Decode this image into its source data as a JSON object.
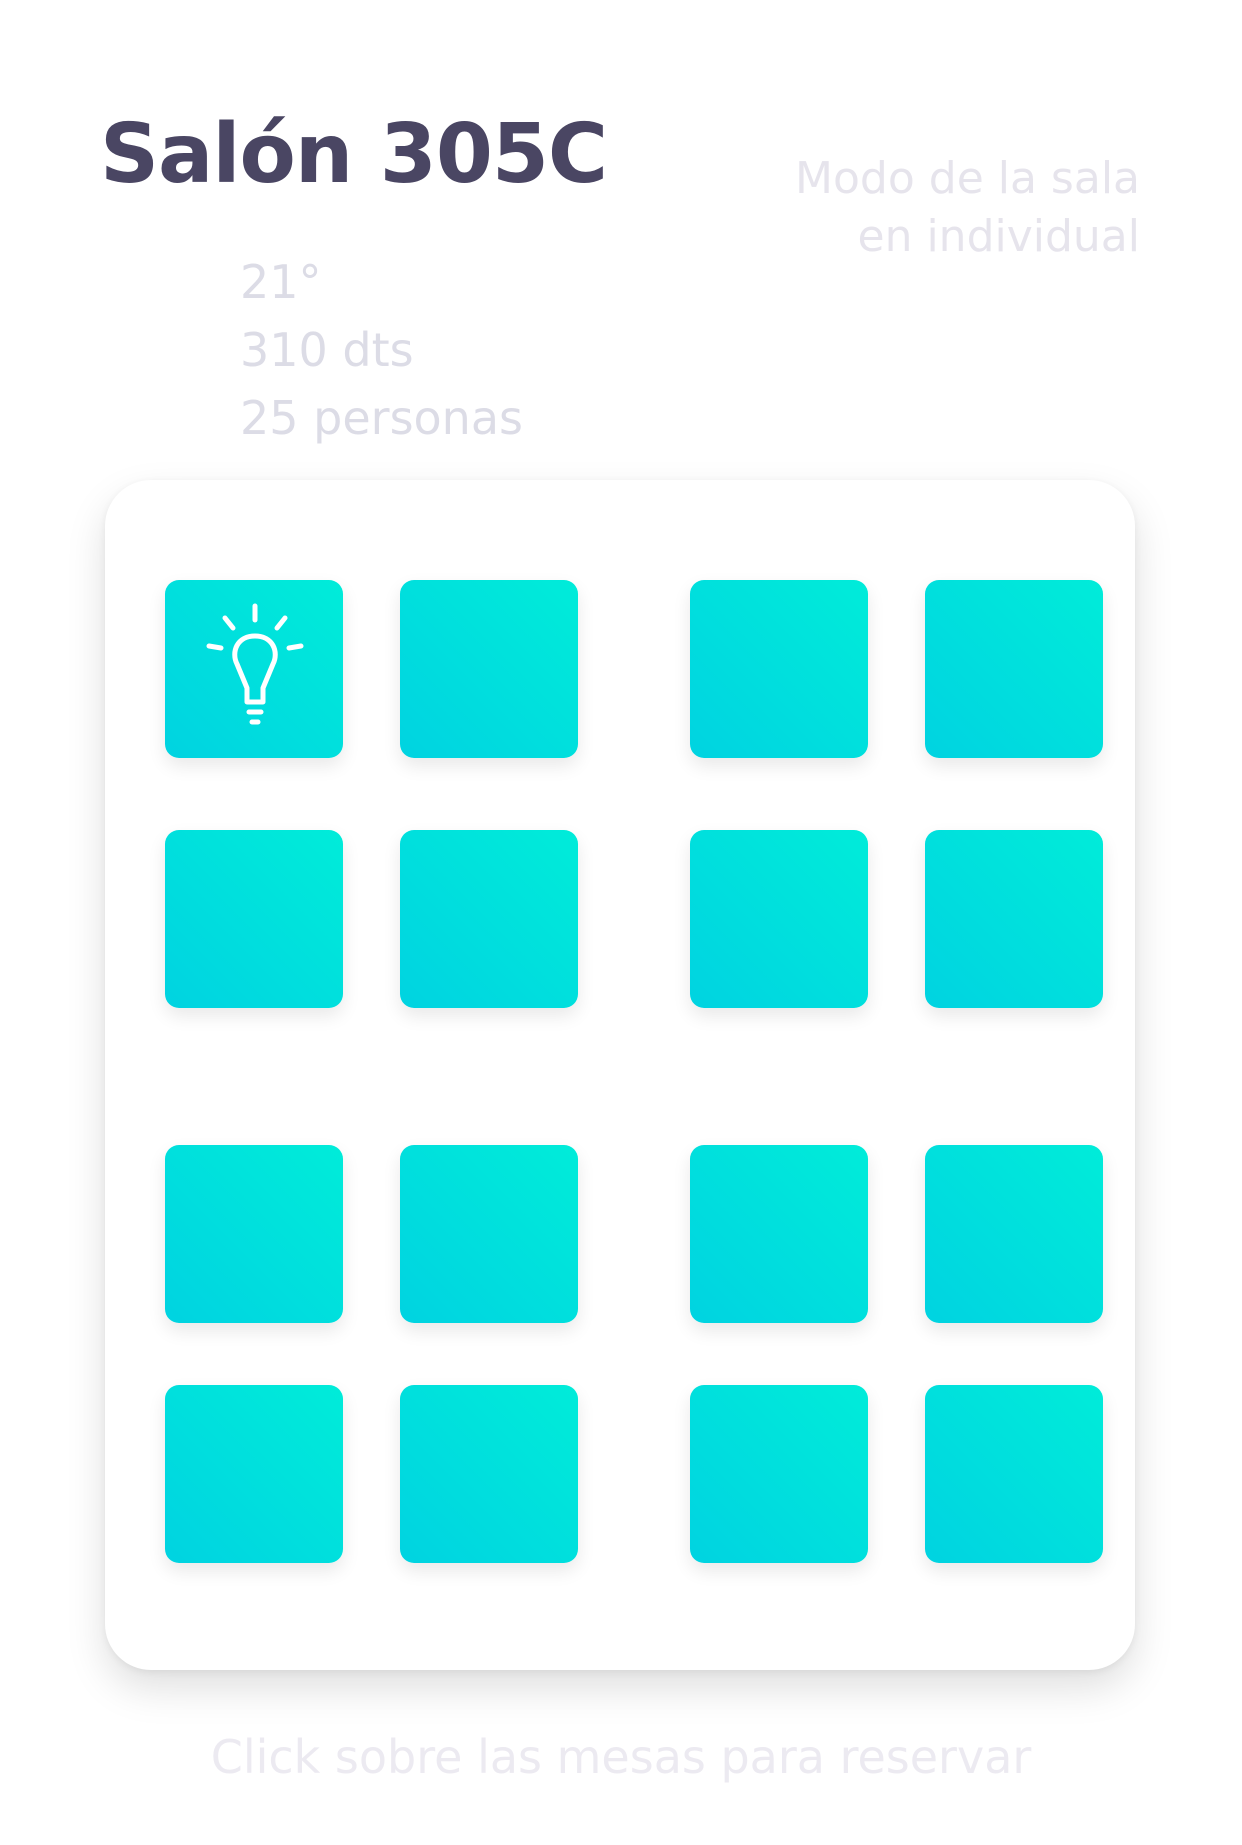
{
  "header": {
    "title": "Salón 305C",
    "mode_line_1": "Modo de la sala",
    "mode_line_2": "en individual"
  },
  "room_info": {
    "floor": "21°",
    "area": "310 dts",
    "capacity": "25 personas"
  },
  "desks": {
    "count": 16,
    "accent_from": "#00ecd9",
    "accent_to": "#00d3e1",
    "highlighted_desk_icon": "lightbulb-icon"
  },
  "footer": {
    "hint": "Click sobre las mesas para reservar"
  }
}
